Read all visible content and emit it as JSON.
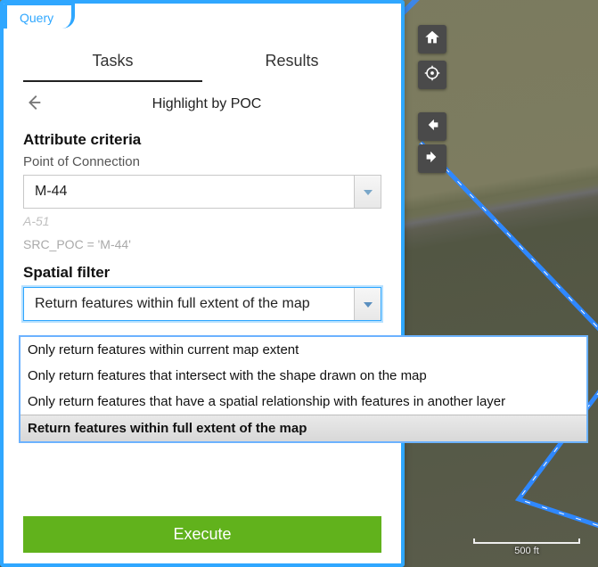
{
  "panel": {
    "tab_label": "Query",
    "tabs": {
      "tasks": "Tasks",
      "results": "Results",
      "active": "tasks"
    },
    "subtask_title": "Highlight by POC",
    "attribute": {
      "heading": "Attribute criteria",
      "field_label": "Point of Connection",
      "selected_value": "M-44",
      "next_suggestion": "A-51",
      "sql_preview": "SRC_POC = 'M-44'"
    },
    "spatial": {
      "heading": "Spatial filter",
      "selected_value": "Return features within full extent of the map",
      "options": [
        "Only return features within current map extent",
        "Only return features that intersect with the shape drawn on the map",
        "Only return features that have a spatial relationship with features in another layer",
        "Return features within full extent of the map"
      ]
    },
    "execute_label": "Execute"
  },
  "map": {
    "tools": {
      "home": "home-icon",
      "locate": "locate-icon",
      "prev_extent": "arrow-left-icon",
      "next_extent": "arrow-right-icon"
    },
    "scalebar_label": "500 ft"
  },
  "colors": {
    "accent": "#2fa7ff",
    "execute": "#61b21c",
    "tool_bg": "#4a4a4a"
  }
}
